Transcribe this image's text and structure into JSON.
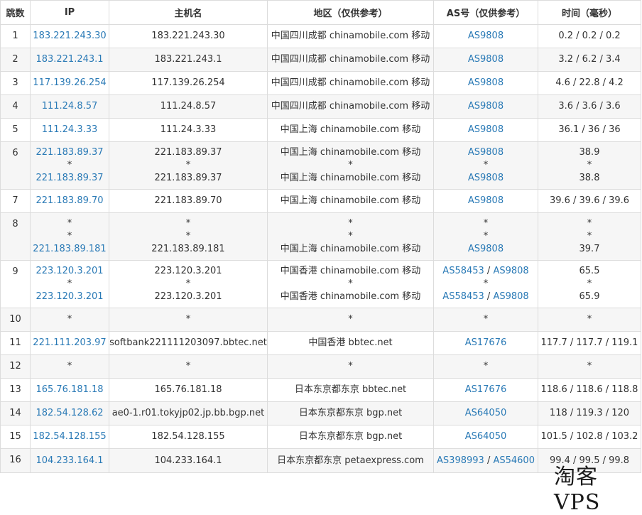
{
  "colors": {
    "link": "#2a7ab6",
    "border": "#dcdcdc",
    "stripe": "#f6f6f6",
    "text": "#333333"
  },
  "headers": [
    "跳数",
    "IP",
    "主机名",
    "地区（仅供参考）",
    "AS号（仅供参考）",
    "时间（毫秒）"
  ],
  "rows": [
    {
      "hop": "1",
      "ip": [
        "183.221.243.30"
      ],
      "host": [
        "183.221.243.30"
      ],
      "region": [
        "中国四川成都 chinamobile.com 移动"
      ],
      "as": [
        [
          "AS9808"
        ]
      ],
      "time": [
        "0.2 / 0.2 / 0.2"
      ]
    },
    {
      "hop": "2",
      "ip": [
        "183.221.243.1"
      ],
      "host": [
        "183.221.243.1"
      ],
      "region": [
        "中国四川成都 chinamobile.com 移动"
      ],
      "as": [
        [
          "AS9808"
        ]
      ],
      "time": [
        "3.2 / 6.2 / 3.4"
      ]
    },
    {
      "hop": "3",
      "ip": [
        "117.139.26.254"
      ],
      "host": [
        "117.139.26.254"
      ],
      "region": [
        "中国四川成都 chinamobile.com 移动"
      ],
      "as": [
        [
          "AS9808"
        ]
      ],
      "time": [
        "4.6 / 22.8 / 4.2"
      ]
    },
    {
      "hop": "4",
      "ip": [
        "111.24.8.57"
      ],
      "host": [
        "111.24.8.57"
      ],
      "region": [
        "中国四川成都 chinamobile.com 移动"
      ],
      "as": [
        [
          "AS9808"
        ]
      ],
      "time": [
        "3.6 / 3.6 / 3.6"
      ]
    },
    {
      "hop": "5",
      "ip": [
        "111.24.3.33"
      ],
      "host": [
        "111.24.3.33"
      ],
      "region": [
        "中国上海 chinamobile.com 移动"
      ],
      "as": [
        [
          "AS9808"
        ]
      ],
      "time": [
        "36.1 / 36 / 36"
      ]
    },
    {
      "hop": "6",
      "ip": [
        "221.183.89.37",
        "*",
        "221.183.89.37"
      ],
      "host": [
        "221.183.89.37",
        "*",
        "221.183.89.37"
      ],
      "region": [
        "中国上海 chinamobile.com 移动",
        "*",
        "中国上海 chinamobile.com 移动"
      ],
      "as": [
        [
          "AS9808"
        ],
        [
          "*"
        ],
        [
          "AS9808"
        ]
      ],
      "time": [
        "38.9",
        "*",
        "38.8"
      ]
    },
    {
      "hop": "7",
      "ip": [
        "221.183.89.70"
      ],
      "host": [
        "221.183.89.70"
      ],
      "region": [
        "中国上海 chinamobile.com 移动"
      ],
      "as": [
        [
          "AS9808"
        ]
      ],
      "time": [
        "39.6 / 39.6 / 39.6"
      ]
    },
    {
      "hop": "8",
      "ip": [
        "*",
        "*",
        "221.183.89.181"
      ],
      "host": [
        "*",
        "*",
        "221.183.89.181"
      ],
      "region": [
        "*",
        "*",
        "中国上海 chinamobile.com 移动"
      ],
      "as": [
        [
          "*"
        ],
        [
          "*"
        ],
        [
          "AS9808"
        ]
      ],
      "time": [
        "*",
        "*",
        "39.7"
      ]
    },
    {
      "hop": "9",
      "ip": [
        "223.120.3.201",
        "*",
        "223.120.3.201"
      ],
      "host": [
        "223.120.3.201",
        "*",
        "223.120.3.201"
      ],
      "region": [
        "中国香港 chinamobile.com 移动",
        "*",
        "中国香港 chinamobile.com 移动"
      ],
      "as": [
        [
          "AS58453",
          "AS9808"
        ],
        [
          "*"
        ],
        [
          "AS58453",
          "AS9808"
        ]
      ],
      "time": [
        "65.5",
        "*",
        "65.9"
      ]
    },
    {
      "hop": "10",
      "ip": [
        "*"
      ],
      "host": [
        "*"
      ],
      "region": [
        "*"
      ],
      "as": [
        [
          "*"
        ]
      ],
      "time": [
        "*"
      ]
    },
    {
      "hop": "11",
      "ip": [
        "221.111.203.97"
      ],
      "host": [
        "softbank221111203097.bbtec.net"
      ],
      "region": [
        "中国香港 bbtec.net"
      ],
      "as": [
        [
          "AS17676"
        ]
      ],
      "time": [
        "117.7 / 117.7 / 119.1"
      ]
    },
    {
      "hop": "12",
      "ip": [
        "*"
      ],
      "host": [
        "*"
      ],
      "region": [
        "*"
      ],
      "as": [
        [
          "*"
        ]
      ],
      "time": [
        "*"
      ]
    },
    {
      "hop": "13",
      "ip": [
        "165.76.181.18"
      ],
      "host": [
        "165.76.181.18"
      ],
      "region": [
        "日本东京都东京 bbtec.net"
      ],
      "as": [
        [
          "AS17676"
        ]
      ],
      "time": [
        "118.6 / 118.6 / 118.8"
      ]
    },
    {
      "hop": "14",
      "ip": [
        "182.54.128.62"
      ],
      "host": [
        "ae0-1.r01.tokyjp02.jp.bb.bgp.net"
      ],
      "region": [
        "日本东京都东京 bgp.net"
      ],
      "as": [
        [
          "AS64050"
        ]
      ],
      "time": [
        "118 / 119.3 / 120"
      ]
    },
    {
      "hop": "15",
      "ip": [
        "182.54.128.155"
      ],
      "host": [
        "182.54.128.155"
      ],
      "region": [
        "日本东京都东京 bgp.net"
      ],
      "as": [
        [
          "AS64050"
        ]
      ],
      "time": [
        "101.5 / 102.8 / 103.2"
      ]
    },
    {
      "hop": "16",
      "ip": [
        "104.233.164.1"
      ],
      "host": [
        "104.233.164.1"
      ],
      "region": [
        "日本东京都东京 petaexpress.com"
      ],
      "as": [
        [
          "AS398993",
          "AS54600"
        ]
      ],
      "time": [
        "99.4 / 99.5 / 99.8"
      ]
    }
  ],
  "watermark": "淘客VPS"
}
